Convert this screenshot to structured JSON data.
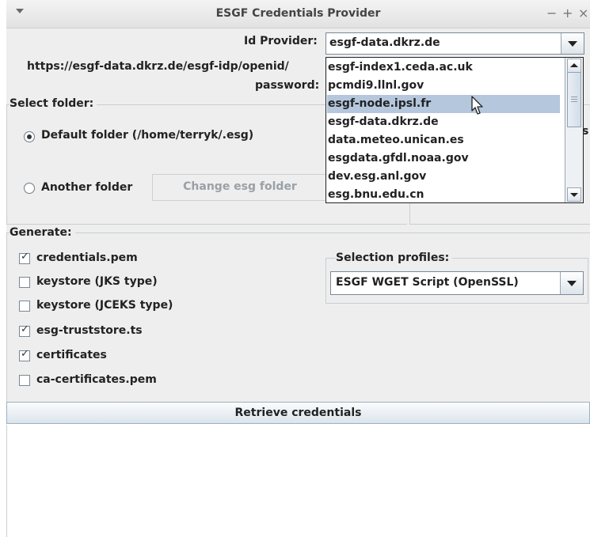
{
  "window": {
    "title": "ESGF Credentials Provider",
    "minimize": "−",
    "maximize": "+",
    "close": "×"
  },
  "id_provider": {
    "label": "Id Provider:",
    "selected": "esgf-data.dkrz.de"
  },
  "openid": {
    "value": "https://esgf-data.dkrz.de/esgf-idp/openid/"
  },
  "password": {
    "label": "password:"
  },
  "folder": {
    "title": "Select folder:",
    "default_label": "Default folder (/home/terryk/.esg)",
    "default_selected": true,
    "another_label": "Another folder",
    "another_selected": false,
    "change_button": "Change esg folder",
    "partial_right": "s"
  },
  "generate": {
    "title": "Generate:",
    "options": [
      {
        "label": "credentials.pem",
        "checked": true
      },
      {
        "label": "keystore (JKS type)",
        "checked": false
      },
      {
        "label": "keystore (JCEKS type)",
        "checked": false
      },
      {
        "label": "esg-truststore.ts",
        "checked": true
      },
      {
        "label": "certificates",
        "checked": true
      },
      {
        "label": "ca-certificates.pem",
        "checked": false
      }
    ]
  },
  "profiles": {
    "title": "Selection profiles:",
    "selected": "ESGF WGET Script (OpenSSL)"
  },
  "retrieve_button": "Retrieve credentials",
  "dropdown": {
    "items": [
      "esgf-index1.ceda.ac.uk",
      "pcmdi9.llnl.gov",
      "esgf-node.ipsl.fr",
      "esgf-data.dkrz.de",
      "data.meteo.unican.es",
      "esgdata.gfdl.noaa.gov",
      "dev.esg.anl.gov",
      "esg.bnu.edu.cn"
    ],
    "highlighted_index": 2
  },
  "icons": {
    "window_menu": "chevron-down-icon",
    "cursor": "mouse-pointer-icon",
    "check": "checkmark-icon"
  }
}
